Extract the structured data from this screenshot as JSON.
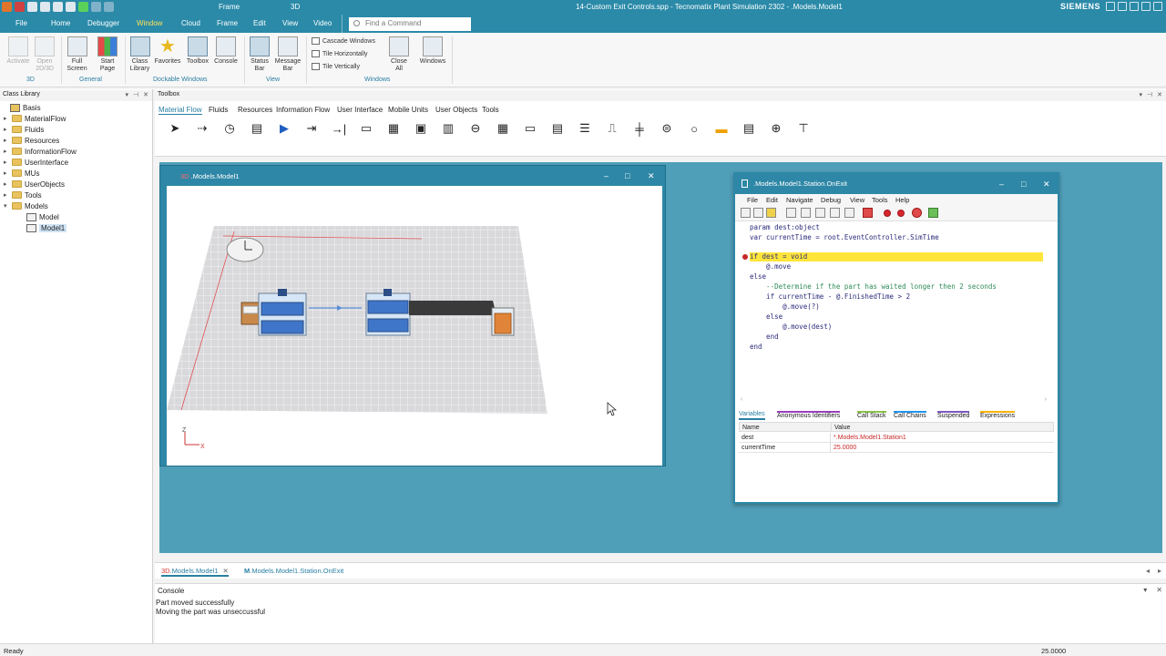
{
  "titlebar": {
    "title": "14-Custom Exit Controls.spp - Tecnomatix Plant Simulation 2302 - .Models.Model1",
    "context_tab_frame": "Frame",
    "context_tab_3d": "3D",
    "brand": "SIEMENS"
  },
  "menubar": {
    "tabs": [
      "File",
      "Home",
      "Debugger",
      "Window",
      "Cloud",
      "Frame",
      "Edit",
      "View",
      "Video"
    ],
    "active": "Window",
    "search_placeholder": "Find a Command"
  },
  "ribbon": {
    "buttons": {
      "activate": "Activate",
      "open2d3d": "Open 2D/3D",
      "fullscreen": "Full Screen",
      "startpage": "Start Page",
      "classlibrary": "Class Library",
      "favorites": "Favorites",
      "toolbox": "Toolbox",
      "console": "Console",
      "statusbar": "Status Bar",
      "messagebar": "Message Bar",
      "cascade": "Cascade Windows",
      "tilehoriz": "Tile Horizontally",
      "tilevert": "Tile Vertically",
      "closeall": "Close All",
      "windows": "Windows"
    },
    "groups": {
      "g3d": "3D",
      "general": "General",
      "dockable": "Dockable Windows",
      "view": "View",
      "windows": "Windows"
    }
  },
  "class_library": {
    "title": "Class Library",
    "items": [
      {
        "label": "Basis",
        "level": 0
      },
      {
        "label": "MaterialFlow",
        "level": 1
      },
      {
        "label": "Fluids",
        "level": 1
      },
      {
        "label": "Resources",
        "level": 1
      },
      {
        "label": "InformationFlow",
        "level": 1
      },
      {
        "label": "UserInterface",
        "level": 1
      },
      {
        "label": "MUs",
        "level": 1
      },
      {
        "label": "UserObjects",
        "level": 1
      },
      {
        "label": "Tools",
        "level": 1
      },
      {
        "label": "Models",
        "level": 1
      },
      {
        "label": "Model",
        "level": 2
      },
      {
        "label": "Model1",
        "level": 2
      }
    ]
  },
  "toolbox": {
    "title": "Toolbox",
    "tabs": [
      "Material Flow",
      "Fluids",
      "Resources",
      "Information Flow",
      "User Interface",
      "Mobile Units",
      "User Objects",
      "Tools"
    ]
  },
  "frame_window": {
    "tag": "3D",
    "title": ".Models.Model1",
    "axis_z": "Z",
    "axis_x": "X"
  },
  "editor": {
    "title": ".Models.Model1.Station.OnExit",
    "menu": [
      "File",
      "Edit",
      "Navigate",
      "Debug",
      "View",
      "Tools",
      "Help"
    ],
    "code": [
      "param dest:object",
      "var currentTime = root.EventController.SimTime",
      "",
      "if dest = void",
      "    @.move",
      "else",
      "    --Determine if the part has waited longer then 2 seconds",
      "    if currentTime - @.FinishedTime > 2",
      "        @.move(?)",
      "    else",
      "        @.move(dest)",
      "    end",
      "end"
    ],
    "debug_tabs": [
      "Variables",
      "Anonymous Identifiers",
      "Call Stack",
      "Call Chains",
      "Suspended",
      "Expressions"
    ],
    "var_headers": [
      "Name",
      "Value"
    ],
    "variables": [
      {
        "name": "dest",
        "value": "*.Models.Model1.Station1"
      },
      {
        "name": "currentTime",
        "value": "25.0000"
      }
    ]
  },
  "doc_tabs": [
    {
      "prefix": "3D",
      "label": ".Models.Model1"
    },
    {
      "prefix": "M",
      "label": ".Models.Model1.Station.OnExit"
    }
  ],
  "console": {
    "title": "Console",
    "messages": [
      "Part moved successfully",
      "Moving the part was unseccussful"
    ]
  },
  "status": {
    "left": "Ready",
    "right": "25.0000"
  },
  "colors": {
    "accent": "#2a8aa8",
    "workspace": "#509fb9",
    "highlight": "#ffe53b",
    "breakpoint": "#c62828"
  }
}
